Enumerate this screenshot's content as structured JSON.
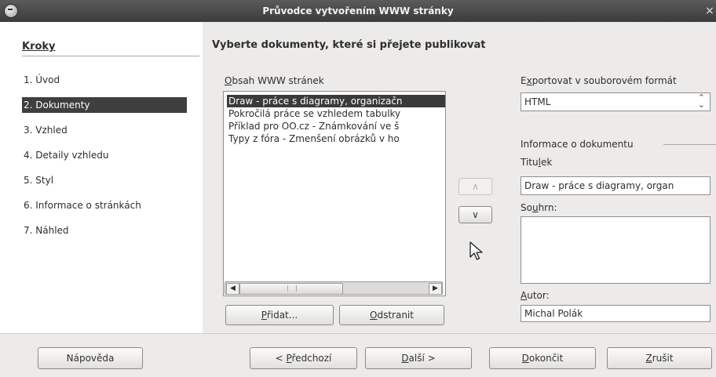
{
  "window": {
    "title": "Průvodce vytvořením WWW stránky",
    "close_glyph": "×"
  },
  "steps": {
    "header": "Kroky",
    "items": [
      {
        "label": "1. Úvod",
        "selected": false
      },
      {
        "label": "2. Dokumenty",
        "selected": true
      },
      {
        "label": "3. Vzhled",
        "selected": false
      },
      {
        "label": "4. Detaily vzhledu",
        "selected": false
      },
      {
        "label": "5. Styl",
        "selected": false
      },
      {
        "label": "6. Informace o stránkách",
        "selected": false
      },
      {
        "label": "7. Náhled",
        "selected": false
      }
    ]
  },
  "main": {
    "heading": "Vyberte dokumenty, které si přejete publikovat",
    "contents_label_u": "O",
    "contents_label_rest": "bsah WWW stránek",
    "documents": [
      {
        "label": "Draw - práce s diagramy, organizačn",
        "selected": true
      },
      {
        "label": "Pokročilá práce se vzhledem tabulky",
        "selected": false
      },
      {
        "label": "Příklad pro OO.cz - Známkování ve š",
        "selected": false
      },
      {
        "label": "Typy z fóra - Zmenšení obrázků v ho",
        "selected": false
      }
    ],
    "scroll_left": "◀",
    "scroll_right": "▶",
    "move_up": "∧",
    "move_down": "∨",
    "add_u": "P",
    "add_rest": "řidat...",
    "remove_u": "O",
    "remove_rest": "dstranit"
  },
  "export": {
    "label_pre": "E",
    "label_u": "x",
    "label_rest": "portovat v souborovém formát",
    "format_value": "HTML",
    "spin_up": "⌃",
    "spin_down": "⌄"
  },
  "info": {
    "group_label": "Informace o dokumentu",
    "title_pre": "Titu",
    "title_u": "l",
    "title_rest": "ek",
    "title_value": "Draw - práce s diagramy, organ",
    "summary_pre": "So",
    "summary_u": "u",
    "summary_rest": "hrn:",
    "summary_value": "",
    "author_u": "A",
    "author_rest": "utor:",
    "author_value": "Michal Polák"
  },
  "buttons": {
    "help": "Nápověda",
    "back_pre": "< ",
    "back_u": "P",
    "back_rest": "ředchozí",
    "next_u": "D",
    "next_rest": "alší >",
    "finish_u": "D",
    "finish_rest": "okončit",
    "cancel_u": "Z",
    "cancel_rest": "rušit"
  }
}
